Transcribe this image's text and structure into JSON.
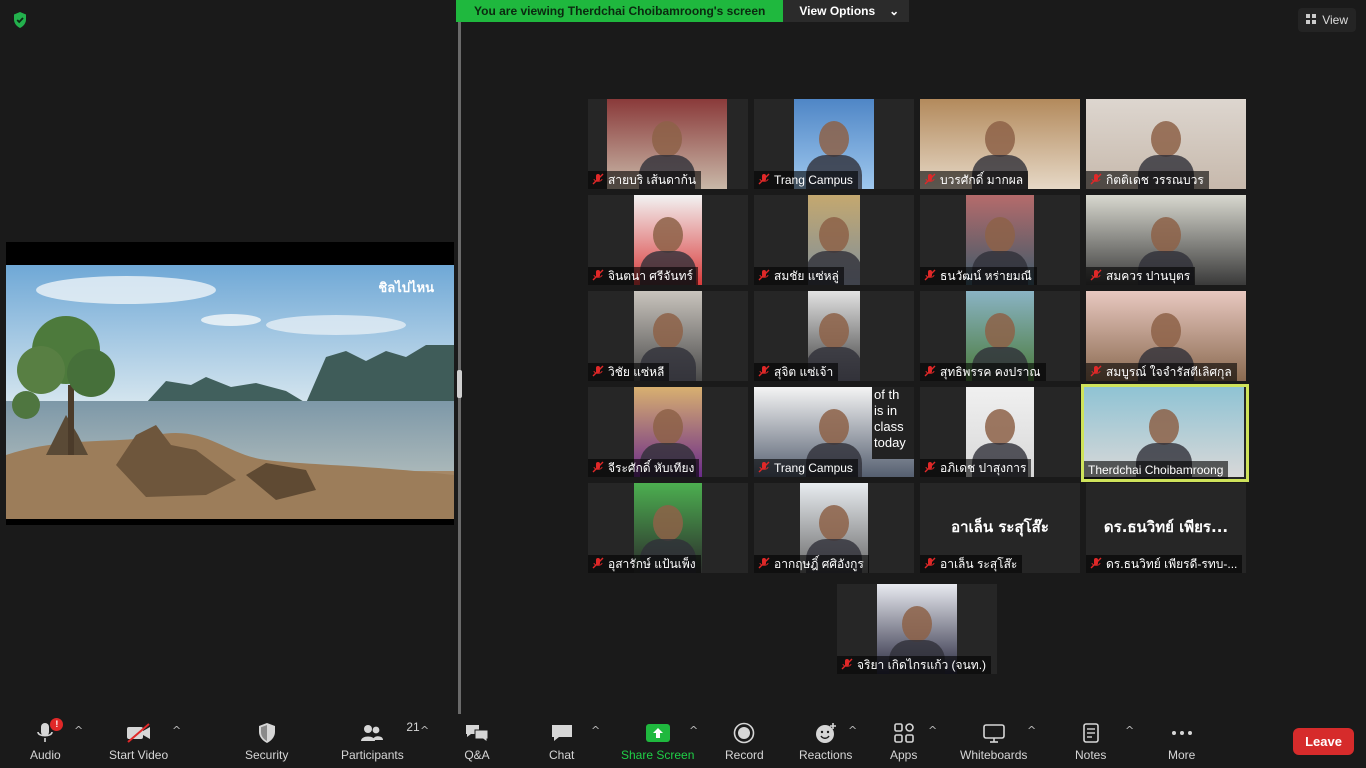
{
  "banner": {
    "text": "You are viewing Therdchai Choibamroong's screen",
    "view_options": "View Options"
  },
  "view_button": {
    "label": "View"
  },
  "share": {
    "watermark": "ชิลไปไหน"
  },
  "participants": [
    {
      "name": "สายบริ เส้นดาก้น"
    },
    {
      "name": "Trang Campus"
    },
    {
      "name": "บวรศักดิ์ มากผล"
    },
    {
      "name": "กิตติเดช วรรณบวร"
    },
    {
      "name": "จินตนา ศรีจันทร์"
    },
    {
      "name": "สมชัย แซ่หลู่"
    },
    {
      "name": "ธนวัฒน์ หร่ายมณี"
    },
    {
      "name": "สมควร ปานบุตร"
    },
    {
      "name": "วิชัย แซ่หลี"
    },
    {
      "name": "สุจิต แซ่เจ้า"
    },
    {
      "name": "สุทธิพรรค คงปราณ"
    },
    {
      "name": "สมบูรณ์ ใจจำรัสตีเลิศกุล"
    },
    {
      "name": "จีระศักดิ์ หับเทียง"
    },
    {
      "name": "Trang Campus",
      "screen_text": "of th\nis in\nclass\ntoday"
    },
    {
      "name": "อภิเดช ปาสุงการ"
    },
    {
      "name": "Therdchai Choibamroong"
    },
    {
      "name": "อุสารักษ์ แป้นเพ็ง"
    },
    {
      "name": "อากฤษฎิ์ ศศิอังกูร"
    },
    {
      "name": "อาเล็น ระสุโส๊ะ",
      "big": "อาเล็น ระสุโส๊ะ"
    },
    {
      "name": "ดร.ธนวิทย์ เพียรดี-รทบ-...",
      "big": "ดร.ธนวิทย์ เพียร..."
    },
    {
      "name": "จริยา เกิดไกรแก้ว (จนท.)"
    }
  ],
  "toolbar": {
    "audio": "Audio",
    "audio_badge": "!",
    "start_video": "Start Video",
    "security": "Security",
    "participants": "Participants",
    "participants_count": "21",
    "qa": "Q&A",
    "chat": "Chat",
    "share_screen": "Share Screen",
    "record": "Record",
    "reactions": "Reactions",
    "apps": "Apps",
    "whiteboards": "Whiteboards",
    "notes": "Notes",
    "more": "More",
    "leave": "Leave"
  }
}
